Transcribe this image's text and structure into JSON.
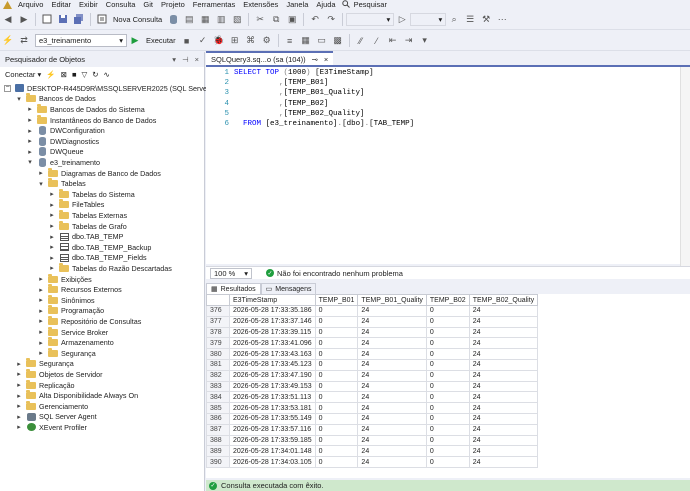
{
  "menu": {
    "items": [
      "Arquivo",
      "Editar",
      "Exibir",
      "Consulta",
      "Git",
      "Projeto",
      "Ferramentas",
      "Extensões",
      "Janela",
      "Ajuda"
    ],
    "search_label": "Pesquisar"
  },
  "toolbar1": {
    "new_query_label": "Nova Consulta"
  },
  "toolbar2": {
    "database": "e3_treinamento",
    "execute_label": "Executar"
  },
  "object_explorer": {
    "title": "Pesquisador de Objetos",
    "connect_label": "Conectar",
    "nodes": [
      {
        "label": "DESKTOP-R445D9R\\MSSQLSERVER2025 (SQL Server 17.0.",
        "level": 0,
        "expander": "−",
        "icon": "server"
      },
      {
        "label": "Bancos de Dados",
        "level": 1,
        "expander": "−",
        "icon": "folder"
      },
      {
        "label": "Bancos de Dados do Sistema",
        "level": 2,
        "expander": "+",
        "icon": "folder"
      },
      {
        "label": "Instantâneos do Banco de Dados",
        "level": 2,
        "expander": "+",
        "icon": "folder"
      },
      {
        "label": "DWConfiguration",
        "level": 2,
        "expander": "+",
        "icon": "database"
      },
      {
        "label": "DWDiagnostics",
        "level": 2,
        "expander": "+",
        "icon": "database"
      },
      {
        "label": "DWQueue",
        "level": 2,
        "expander": "+",
        "icon": "database"
      },
      {
        "label": "e3_treinamento",
        "level": 2,
        "expander": "−",
        "icon": "database"
      },
      {
        "label": "Diagramas de Banco de Dados",
        "level": 3,
        "expander": "+",
        "icon": "folder"
      },
      {
        "label": "Tabelas",
        "level": 3,
        "expander": "−",
        "icon": "folder"
      },
      {
        "label": "Tabelas do Sistema",
        "level": 4,
        "expander": "+",
        "icon": "folder"
      },
      {
        "label": "FileTables",
        "level": 4,
        "expander": "+",
        "icon": "folder"
      },
      {
        "label": "Tabelas Externas",
        "level": 4,
        "expander": "+",
        "icon": "folder"
      },
      {
        "label": "Tabelas de Grafo",
        "level": 4,
        "expander": "+",
        "icon": "folder"
      },
      {
        "label": "dbo.TAB_TEMP",
        "level": 4,
        "expander": "+",
        "icon": "table"
      },
      {
        "label": "dbo.TAB_TEMP_Backup",
        "level": 4,
        "expander": "+",
        "icon": "table"
      },
      {
        "label": "dbo.TAB_TEMP_Fields",
        "level": 4,
        "expander": "+",
        "icon": "table"
      },
      {
        "label": "Tabelas do Razão Descartadas",
        "level": 4,
        "expander": "+",
        "icon": "folder"
      },
      {
        "label": "Exibições",
        "level": 3,
        "expander": "+",
        "icon": "folder"
      },
      {
        "label": "Recursos Externos",
        "level": 3,
        "expander": "+",
        "icon": "folder"
      },
      {
        "label": "Sinônimos",
        "level": 3,
        "expander": "+",
        "icon": "folder"
      },
      {
        "label": "Programação",
        "level": 3,
        "expander": "+",
        "icon": "folder"
      },
      {
        "label": "Repositório de Consultas",
        "level": 3,
        "expander": "+",
        "icon": "folder"
      },
      {
        "label": "Service Broker",
        "level": 3,
        "expander": "+",
        "icon": "folder"
      },
      {
        "label": "Armazenamento",
        "level": 3,
        "expander": "+",
        "icon": "folder"
      },
      {
        "label": "Segurança",
        "level": 3,
        "expander": "+",
        "icon": "folder"
      },
      {
        "label": "Segurança",
        "level": 1,
        "expander": "+",
        "icon": "folder"
      },
      {
        "label": "Objetos de Servidor",
        "level": 1,
        "expander": "+",
        "icon": "folder"
      },
      {
        "label": "Replicação",
        "level": 1,
        "expander": "+",
        "icon": "folder"
      },
      {
        "label": "Alta Disponibilidade Always On",
        "level": 1,
        "expander": "+",
        "icon": "folder"
      },
      {
        "label": "Gerenciamento",
        "level": 1,
        "expander": "+",
        "icon": "folder"
      },
      {
        "label": "SQL Server Agent",
        "level": 1,
        "expander": "+",
        "icon": "agent"
      },
      {
        "label": "XEvent Profiler",
        "level": 1,
        "expander": "+",
        "icon": "xevent"
      }
    ]
  },
  "editor": {
    "tab_label": "SQLQuery3.sq...o (sa (104))",
    "lines": [
      {
        "n": "1",
        "segments": [
          [
            "kw",
            "SELECT TOP "
          ],
          [
            "gr",
            "("
          ],
          [
            "tx",
            "1000"
          ],
          [
            "gr",
            ")"
          ],
          [
            "tx",
            " [E3TimeStamp]"
          ]
        ]
      },
      {
        "n": "2",
        "segments": [
          [
            "tx",
            "          "
          ],
          [
            "gr",
            ","
          ],
          [
            "tx",
            "[TEMP_B01]"
          ]
        ]
      },
      {
        "n": "3",
        "segments": [
          [
            "tx",
            "          "
          ],
          [
            "gr",
            ","
          ],
          [
            "tx",
            "[TEMP_B01_Quality]"
          ]
        ]
      },
      {
        "n": "4",
        "segments": [
          [
            "tx",
            "          "
          ],
          [
            "gr",
            ","
          ],
          [
            "tx",
            "[TEMP_B02]"
          ]
        ]
      },
      {
        "n": "5",
        "segments": [
          [
            "tx",
            "          "
          ],
          [
            "gr",
            ","
          ],
          [
            "tx",
            "[TEMP_B02_Quality]"
          ]
        ]
      },
      {
        "n": "6",
        "segments": [
          [
            "tx",
            "  "
          ],
          [
            "kw",
            "FROM "
          ],
          [
            "tx",
            "[e3_treinamento]"
          ],
          [
            "gr",
            "."
          ],
          [
            "tx",
            "[dbo]"
          ],
          [
            "gr",
            "."
          ],
          [
            "tx",
            "[TAB_TEMP]"
          ]
        ]
      }
    ]
  },
  "status_mid": {
    "zoom": "100 %",
    "message": "Não foi encontrado nenhum problema"
  },
  "results": {
    "tabs": [
      "Resultados",
      "Mensagens"
    ],
    "columns": [
      "E3TimeStamp",
      "TEMP_B01",
      "TEMP_B01_Quality",
      "TEMP_B02",
      "TEMP_B02_Quality"
    ],
    "rows": [
      [
        "376",
        "2026-05-28 17:33:35.186",
        "0",
        "24",
        "0",
        "24"
      ],
      [
        "377",
        "2026-05-28 17:33:37.146",
        "0",
        "24",
        "0",
        "24"
      ],
      [
        "378",
        "2026-05-28 17:33:39.115",
        "0",
        "24",
        "0",
        "24"
      ],
      [
        "379",
        "2026-05-28 17:33:41.096",
        "0",
        "24",
        "0",
        "24"
      ],
      [
        "380",
        "2026-05-28 17:33:43.163",
        "0",
        "24",
        "0",
        "24"
      ],
      [
        "381",
        "2026-05-28 17:33:45.123",
        "0",
        "24",
        "0",
        "24"
      ],
      [
        "382",
        "2026-05-28 17:33:47.190",
        "0",
        "24",
        "0",
        "24"
      ],
      [
        "383",
        "2026-05-28 17:33:49.153",
        "0",
        "24",
        "0",
        "24"
      ],
      [
        "384",
        "2026-05-28 17:33:51.113",
        "0",
        "24",
        "0",
        "24"
      ],
      [
        "385",
        "2026-05-28 17:33:53.181",
        "0",
        "24",
        "0",
        "24"
      ],
      [
        "386",
        "2026-05-28 17:33:55.149",
        "0",
        "24",
        "0",
        "24"
      ],
      [
        "387",
        "2026-05-28 17:33:57.116",
        "0",
        "24",
        "0",
        "24"
      ],
      [
        "388",
        "2026-05-28 17:33:59.185",
        "0",
        "24",
        "0",
        "24"
      ],
      [
        "389",
        "2026-05-28 17:34:01.148",
        "0",
        "24",
        "0",
        "24"
      ],
      [
        "390",
        "2026-05-28 17:34:03.105",
        "0",
        "24",
        "0",
        "24"
      ]
    ]
  },
  "statusbar": {
    "message": "Consulta executada com êxito."
  },
  "colors": {
    "accent": "#5b6fb5",
    "success": "#1f9e3e",
    "status_bg": "#cfe8cc",
    "folder": "#e9c15a"
  }
}
